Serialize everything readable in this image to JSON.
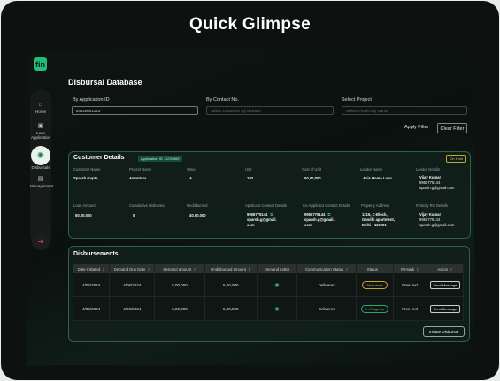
{
  "heading": "Quick Glimpse",
  "app": {
    "logo": "fin",
    "page_title": "Disbursal Database"
  },
  "nav": [
    {
      "label": "Home",
      "icon": "home-icon",
      "glyph": "⌂"
    },
    {
      "label": "Loan Application",
      "icon": "document-icon",
      "glyph": "▣"
    },
    {
      "label": "Disbursals",
      "icon": "disbursal-icon",
      "glyph": "✺"
    },
    {
      "label": "Management",
      "icon": "folder-icon",
      "glyph": "▤"
    }
  ],
  "logout_glyph": "⇥",
  "filters": {
    "application_id": {
      "label": "By Application ID",
      "value": "84816041123"
    },
    "contact_no": {
      "label": "By Contact No.",
      "placeholder": "Select Customer By Number"
    },
    "project": {
      "label": "Select Project",
      "placeholder": "Select Project By Name"
    },
    "apply_label": "Apply Filter",
    "clear_label": "Clear Filter"
  },
  "customer": {
    "title": "Customer Details",
    "app_id_badge": "Application ID : 1234569",
    "status_badge": "On Hold",
    "row1": {
      "customer_name": {
        "label": "Customer Name",
        "value": "Sparsh Gupta"
      },
      "project_name": {
        "label": "Project Name",
        "value": "Amantara"
      },
      "wing": {
        "label": "Wing",
        "value": "A"
      },
      "unit": {
        "label": "Unit",
        "value": "103"
      },
      "cost": {
        "label": "Cost of Unit",
        "value": "50,00,000"
      },
      "lender_name": {
        "label": "Lender Name",
        "value": "Axis Home Loan"
      },
      "lender_details": {
        "label": "Lender Details",
        "l1": "Vijay Kumar",
        "l2": "9958775144",
        "l3": "sparsh.g@gmail.com"
      }
    },
    "row2": {
      "loan_amount": {
        "label": "Loan Amount",
        "value": "50,00,000"
      },
      "cumulative": {
        "label": "Cumulative Disbursed",
        "value": "0"
      },
      "undisbursed": {
        "label": "Undisbursed",
        "value": "40,00,000"
      },
      "applicant_contact": {
        "label": "Applicant Contact Details",
        "l1": "9958775144",
        "l2": "sparsh.g@gmail.",
        "l3": "com"
      },
      "co_applicant": {
        "label": "Co-Applicant Contact Details",
        "l1": "9958775144",
        "l2": "sparsh.g@gmail.",
        "l3": "com"
      },
      "address": {
        "label": "Property Address",
        "l1": "1216, C-Block,",
        "l2": "Gandhi apartment,",
        "l3": "Delhi - 110001"
      },
      "firstcity": {
        "label": "Firstcity Rst Details",
        "l1": "Vijay Kumar",
        "l2": "9958775144",
        "l3": "sparsh.g@gmail.com"
      }
    }
  },
  "disbursements": {
    "title": "Disbursements",
    "columns": [
      "Date Initiated",
      "Demand Due Date",
      "Demand amount",
      "Undisbursed amount",
      "Demand Letter",
      "Communication Status",
      "Status",
      "Remark",
      "Action"
    ],
    "rows": [
      {
        "date": "4/05/2024",
        "due": "4/06/2024",
        "amount": "5,00,000",
        "undisbursed": "5,00,000",
        "comm": "Delivered",
        "status": "Disbursed",
        "status_color": "#e0b84a",
        "remark": "Free text",
        "action": "Send Message"
      },
      {
        "date": "4/05/2024",
        "due": "4/06/2024",
        "amount": "5,00,000",
        "undisbursed": "5,00,000",
        "comm": "Delivered",
        "status": "In Progress",
        "status_color": "#49d08a",
        "remark": "Free text",
        "action": "Send Message"
      }
    ],
    "initiate_label": "Initiate Disbursal"
  }
}
